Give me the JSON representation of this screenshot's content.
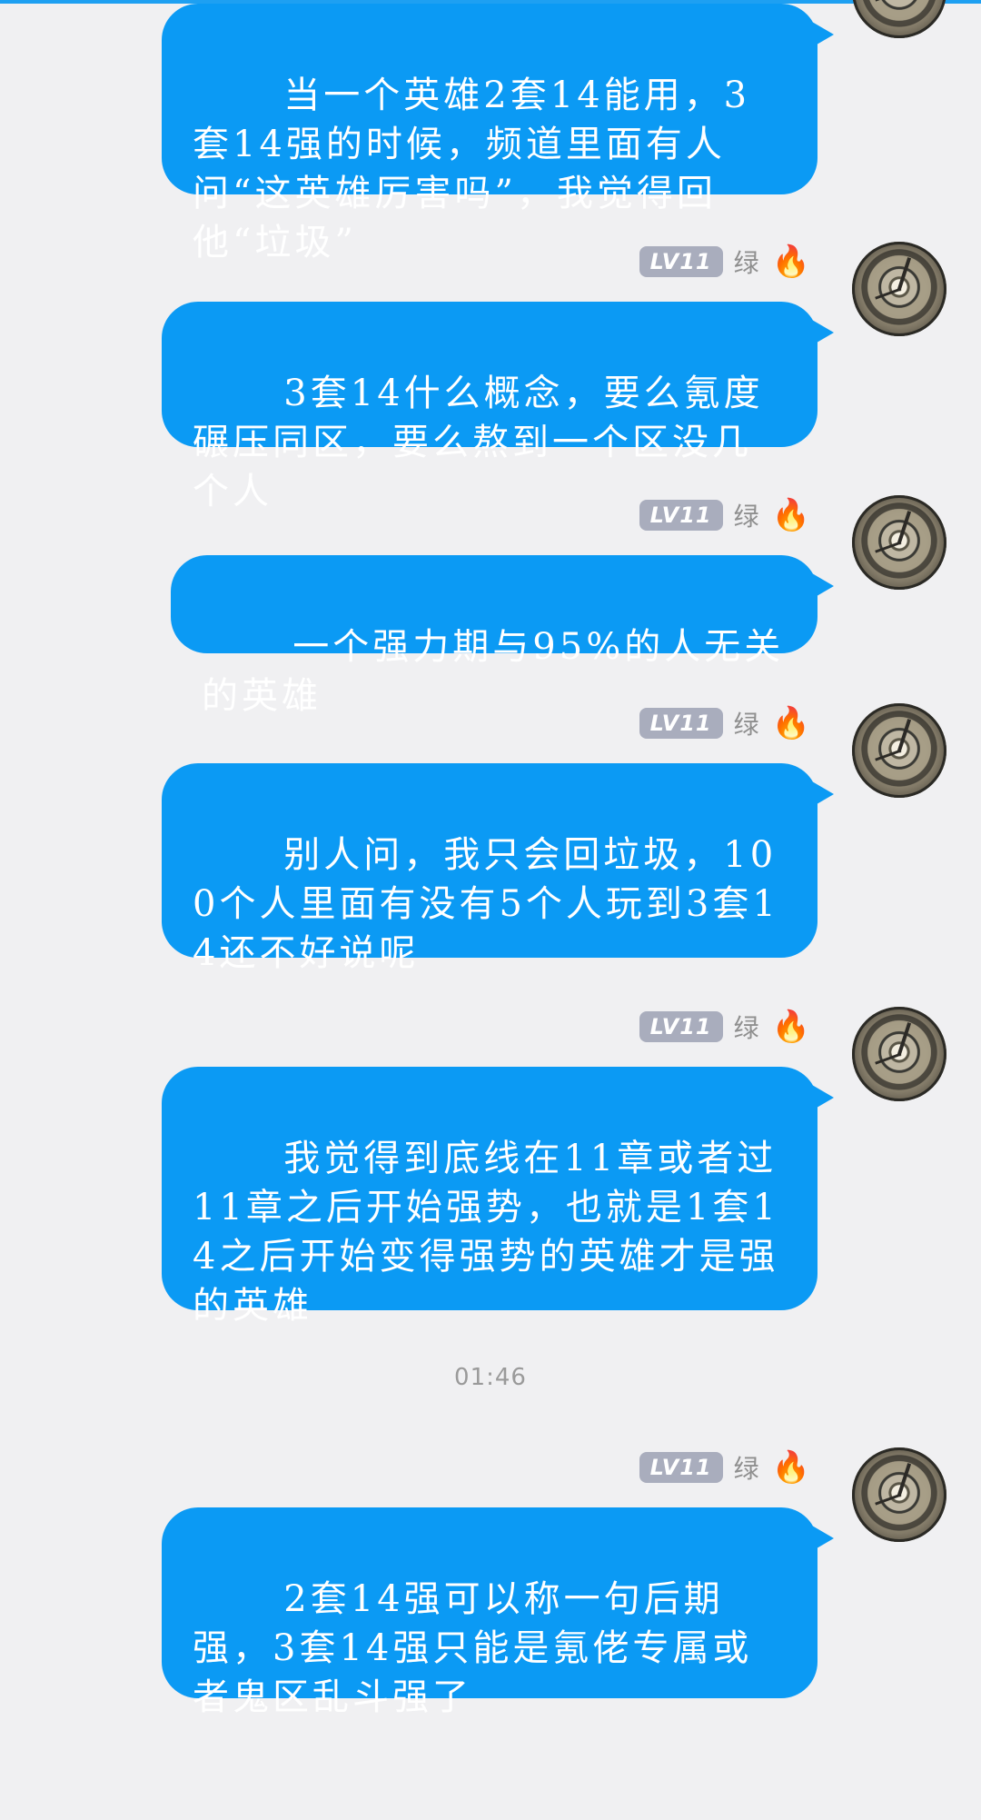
{
  "messages": [
    {
      "text": "当一个英雄2套14能用，3套14强的时候，频道里面有人问“这英雄厉害吗”，我觉得回他“垃圾”"
    },
    {
      "level": "LV11",
      "nickname": "绿",
      "icon": "fire-icon",
      "text": "3套14什么概念，要么氪度碾压同区，要么熬到一个区没几个人"
    },
    {
      "level": "LV11",
      "nickname": "绿",
      "icon": "fire-icon",
      "text": "一个强力期与95%的人无关的英雄"
    },
    {
      "level": "LV11",
      "nickname": "绿",
      "icon": "fire-icon",
      "text": "别人问，我只会回垃圾，100个人里面有没有5个人玩到3套14还不好说呢"
    },
    {
      "level": "LV11",
      "nickname": "绿",
      "icon": "fire-icon",
      "text": "我觉得到底线在11章或者过11章之后开始强势，也就是1套14之后开始变得强势的英雄才是强的英雄"
    },
    {
      "level": "LV11",
      "nickname": "绿",
      "icon": "fire-icon",
      "text": "2套14强可以称一句后期强，3套14强只能是氪佬专属或者鬼区乱斗强了"
    }
  ],
  "timestamp": "01:46",
  "colors": {
    "bubble": "#0b9af4",
    "background": "#f0f0f2",
    "level_badge": "#a9adbd",
    "accent": "#1ea0f2"
  }
}
